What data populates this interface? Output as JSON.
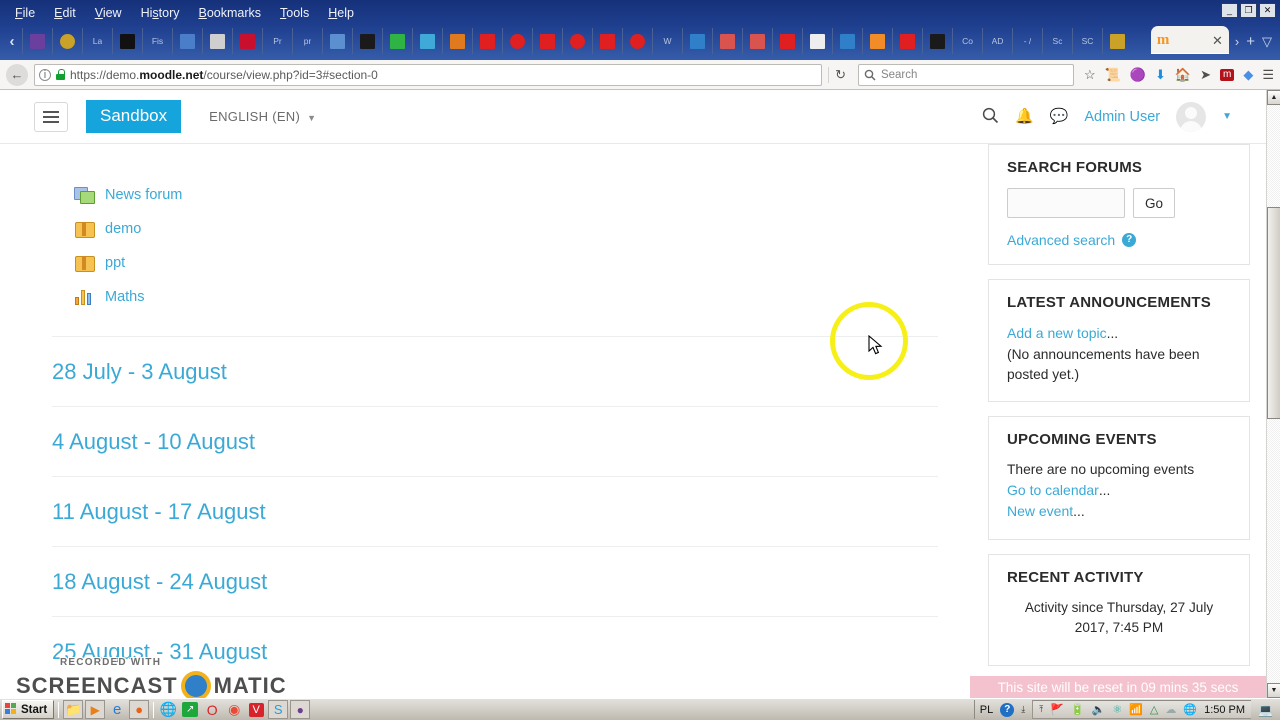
{
  "browser": {
    "menu": [
      "File",
      "Edit",
      "View",
      "History",
      "Bookmarks",
      "Tools",
      "Help"
    ],
    "window_controls": {
      "minimize": "_",
      "restore": "❐",
      "close": "✕"
    },
    "tab_scroll_left": "‹",
    "tab_scroll_right": "›",
    "new_tab": "+",
    "tab_list_menu": "▽",
    "pinned_tabs": [
      {
        "name": "evernote-tab",
        "label": ""
      },
      {
        "name": "audio-tab",
        "label": ""
      },
      {
        "name": "la-tab",
        "label": "La"
      },
      {
        "name": "powerpoint-tab",
        "label": ""
      },
      {
        "name": "fis-tab",
        "label": "Fis"
      },
      {
        "name": "image-tab",
        "label": ""
      },
      {
        "name": "box-tab",
        "label": ""
      },
      {
        "name": "p-tab",
        "label": ""
      },
      {
        "name": "pr-tab",
        "label": "Pr"
      },
      {
        "name": "pr2-tab",
        "label": "pr"
      },
      {
        "name": "cloud-tab",
        "label": ""
      },
      {
        "name": "wiki-tab",
        "label": ""
      },
      {
        "name": "green-tab",
        "label": ""
      },
      {
        "name": "blue-tab",
        "label": ""
      },
      {
        "name": "linkedin-tab",
        "label": ""
      },
      {
        "name": "youtube-tab-1",
        "label": ""
      },
      {
        "name": "opera-tab-1",
        "label": ""
      },
      {
        "name": "youtube-tab-2",
        "label": ""
      },
      {
        "name": "opera-tab-2",
        "label": ""
      },
      {
        "name": "youtube-tab-3",
        "label": ""
      },
      {
        "name": "opera-tab-3",
        "label": ""
      },
      {
        "name": "w-tab",
        "label": "W"
      },
      {
        "name": "trello-tab",
        "label": ""
      },
      {
        "name": "ms-tab-1",
        "label": ""
      },
      {
        "name": "ms-tab-2",
        "label": ""
      },
      {
        "name": "youtube-tab-4",
        "label": ""
      },
      {
        "name": "ghost-tab",
        "label": ""
      },
      {
        "name": "ms-tab-3",
        "label": ""
      },
      {
        "name": "m-orange-tab",
        "label": ""
      },
      {
        "name": "youtube-tab-5",
        "label": ""
      },
      {
        "name": "overbar-tab",
        "label": ""
      },
      {
        "name": "co-tab",
        "label": "Co"
      },
      {
        "name": "ad-tab",
        "label": "AD"
      },
      {
        "name": "dash-tab",
        "label": "- /"
      },
      {
        "name": "sc-tab-1",
        "label": "Sc"
      },
      {
        "name": "sc-tab-2",
        "label": "SC"
      },
      {
        "name": "pen-tab",
        "label": ""
      }
    ],
    "active_tab": {
      "logo": "m",
      "close": "✕"
    },
    "url": {
      "scheme": "https://demo.",
      "domain": "moodle.net",
      "path": "/course/view.php?id=3#section-0"
    },
    "reload_icon": "↻",
    "back_icon": "←",
    "search_placeholder": "Search",
    "nav_icons": [
      "star-icon",
      "library-icon",
      "pocket-icon",
      "downloads-icon",
      "home-icon",
      "send-icon",
      "moodle-extension-icon",
      "diamond-extension-icon",
      "menu-icon"
    ]
  },
  "moodle_header": {
    "menu_button": "menu-icon",
    "brand": "Sandbox",
    "language": "ENGLISH (EN)",
    "language_caret": "▼",
    "search_icon": "search-icon",
    "notifications_icon": "bell-icon",
    "messages_icon": "chat-icon",
    "user_name": "Admin User",
    "user_caret": "▼"
  },
  "course": {
    "activities": [
      {
        "label": "News forum",
        "icon": "forum-icon"
      },
      {
        "label": "demo",
        "icon": "package-icon"
      },
      {
        "label": "ppt",
        "icon": "package-icon"
      },
      {
        "label": "Maths",
        "icon": "survey-chart-icon"
      }
    ],
    "weeks": [
      "28 July - 3 August",
      "4 August - 10 August",
      "11 August - 17 August",
      "18 August - 24 August",
      "25 August - 31 August"
    ]
  },
  "sidebar": {
    "search_forums": {
      "title": "SEARCH FORUMS",
      "input_value": "",
      "go_label": "Go",
      "advanced_search": "Advanced search",
      "help_icon": "?"
    },
    "latest_announcements": {
      "title": "LATEST ANNOUNCEMENTS",
      "add_topic_link": "Add a new topic",
      "add_topic_dots": "...",
      "empty_message": "(No announcements have been posted yet.)"
    },
    "upcoming_events": {
      "title": "UPCOMING EVENTS",
      "empty_message": "There are no upcoming events",
      "calendar_link": "Go to calendar",
      "calendar_dots": "...",
      "new_event_link": "New event",
      "new_event_dots": "..."
    },
    "recent_activity": {
      "title": "RECENT ACTIVITY",
      "since_text": "Activity since Thursday, 27 July 2017, 7:45 PM"
    }
  },
  "reset_banner": "This site will be reset in 09 mins 35 secs",
  "watermark": {
    "line1": "RECORDED WITH",
    "line2a": "SCREENCAST",
    "line2b": "MATIC"
  },
  "taskbar": {
    "start_label": "Start",
    "apps": [
      "explorer-icon",
      "media-player-icon",
      "internet-explorer-icon",
      "firefox-icon",
      "browser-blue-icon",
      "app-green-icon",
      "opera-icon",
      "chrome-icon",
      "vivaldi-icon",
      "skype-icon",
      "tor-icon"
    ],
    "language": "PL",
    "help_icon": "?",
    "tray": [
      "show-hidden-icon",
      "network-blocked-icon",
      "battery-icon",
      "volume-icon",
      "antivirus-icon",
      "signal-icon",
      "google-drive-icon",
      "onedrive-icon",
      "globe-icon"
    ],
    "clock": "1:50 PM",
    "show-desktop": "desktop-icon"
  },
  "scrollbar": {
    "up": "▲",
    "down": "▼"
  },
  "colors": {
    "brand": "#16a4dc",
    "link": "#3ba9d6",
    "banner": "#f4c2ce",
    "cursor_ring": "#f7f018"
  }
}
